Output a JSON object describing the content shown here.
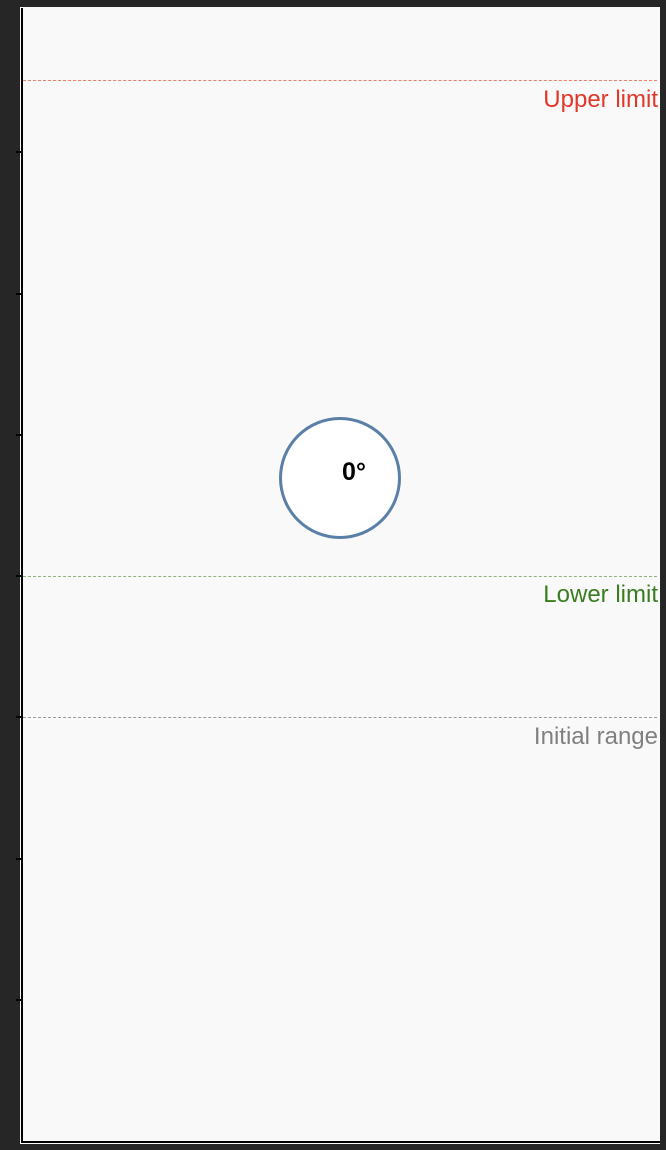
{
  "marker": {
    "value_label": "0°",
    "border_color": "#5a80a8"
  },
  "guides": {
    "upper": {
      "label": "Upper limit",
      "color": "#e0382a"
    },
    "lower": {
      "label": "Lower limit",
      "color": "#3a7d20"
    },
    "initial": {
      "label": "Initial range",
      "color": "#808080"
    }
  }
}
